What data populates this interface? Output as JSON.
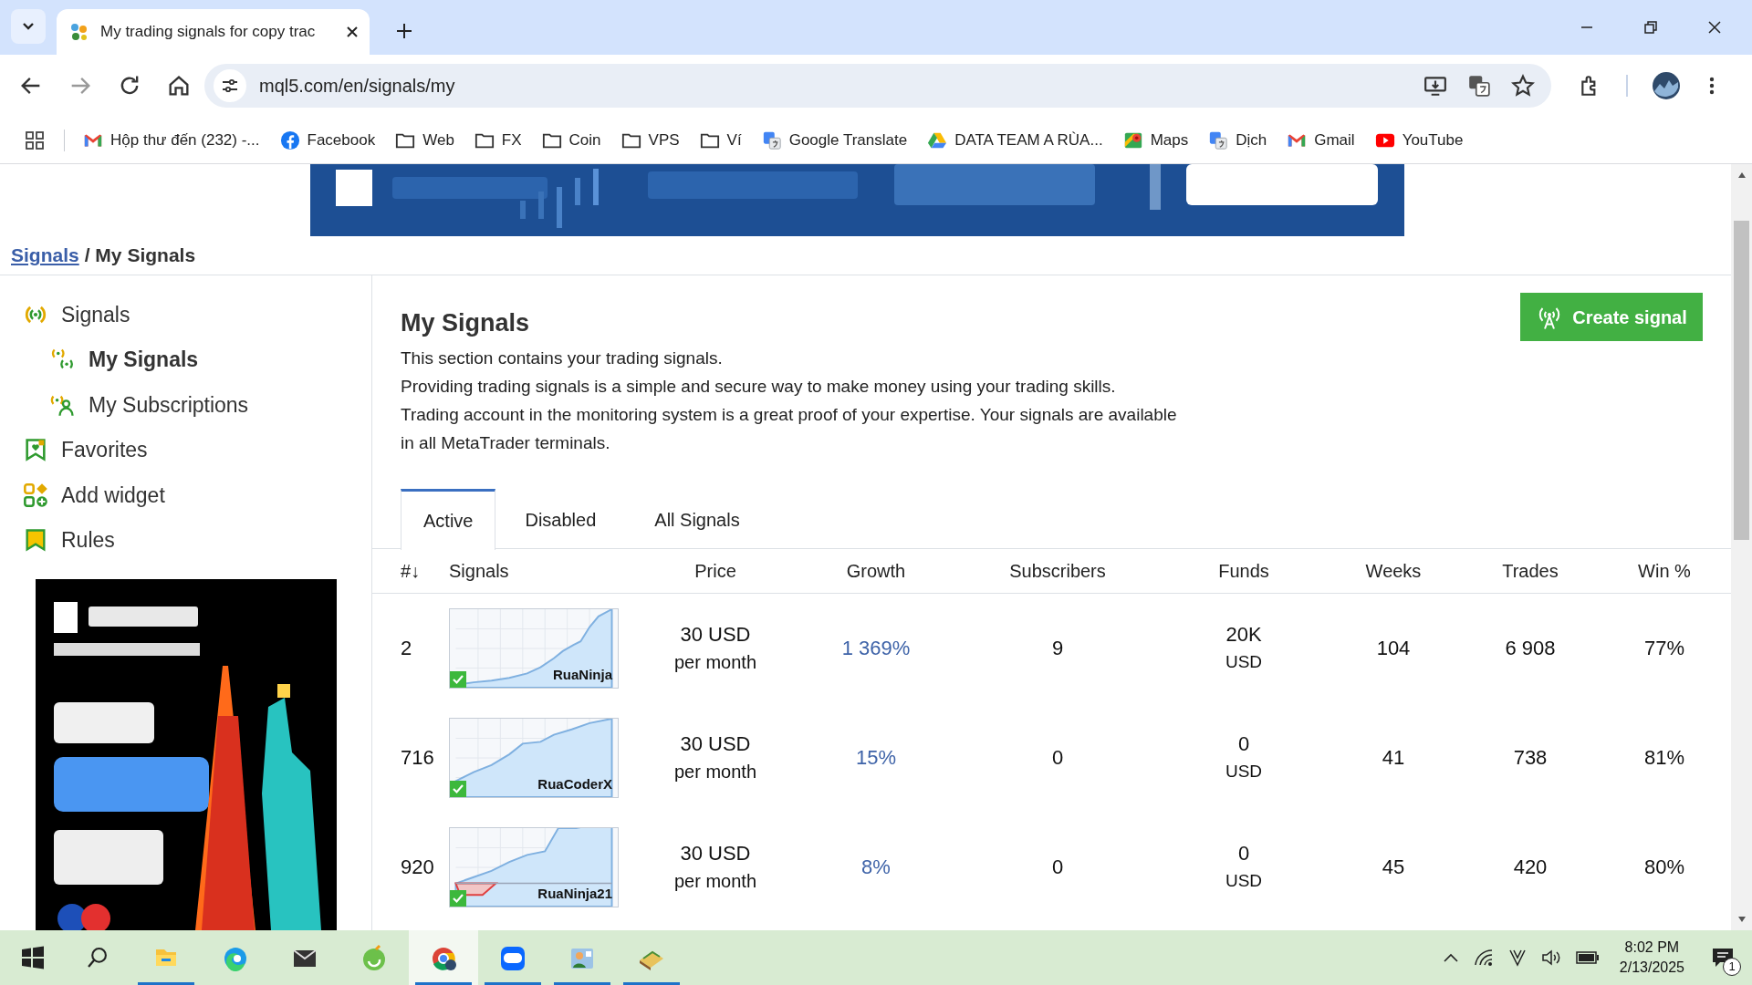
{
  "browser": {
    "tab": {
      "title": "My trading signals for copy trac"
    },
    "address": "mql5.com/en/signals/my",
    "bookmarks": [
      {
        "kind": "gmail",
        "label": "Hộp thư đến (232) -..."
      },
      {
        "kind": "facebook",
        "label": "Facebook"
      },
      {
        "kind": "folder",
        "label": "Web"
      },
      {
        "kind": "folder",
        "label": "FX"
      },
      {
        "kind": "folder",
        "label": "Coin"
      },
      {
        "kind": "folder",
        "label": "VPS"
      },
      {
        "kind": "folder",
        "label": "Ví"
      },
      {
        "kind": "translate",
        "label": "Google Translate"
      },
      {
        "kind": "drive",
        "label": "DATA TEAM A RÙA..."
      },
      {
        "kind": "maps",
        "label": "Maps"
      },
      {
        "kind": "translate",
        "label": "Dịch"
      },
      {
        "kind": "gmail",
        "label": "Gmail"
      },
      {
        "kind": "youtube",
        "label": "YouTube"
      }
    ]
  },
  "breadcrumb": {
    "link": "Signals",
    "current": "/ My Signals"
  },
  "sidebar": {
    "items": [
      {
        "kind": "signal",
        "label": "Signals",
        "selected": false,
        "children": [
          {
            "kind": "signals",
            "label": "My Signals",
            "selected": true
          },
          {
            "kind": "subscriber",
            "label": "My Subscriptions",
            "selected": false
          }
        ]
      },
      {
        "kind": "favorite",
        "label": "Favorites",
        "selected": false
      },
      {
        "kind": "widget",
        "label": "Add widget",
        "selected": false
      },
      {
        "kind": "rules",
        "label": "Rules",
        "selected": false
      }
    ]
  },
  "page": {
    "title": "My Signals",
    "create_button": "Create signal",
    "description": [
      "This section contains your trading signals.",
      "Providing trading signals is a simple and secure way to make money using your trading skills.",
      "Trading account in the monitoring system is a great proof of your expertise. Your signals are available in all MetaTrader terminals."
    ]
  },
  "tabs": [
    {
      "label": "Active",
      "selected": true
    },
    {
      "label": "Disabled",
      "selected": false
    },
    {
      "label": "All Signals",
      "selected": false
    }
  ],
  "table": {
    "columns": [
      "#↓",
      "Signals",
      "Price",
      "Growth",
      "Subscribers",
      "Funds",
      "Weeks",
      "Trades",
      "Win %"
    ],
    "rows": [
      {
        "rank": "2",
        "signal": "RuaNinja",
        "price": "30 USD",
        "price_period": "per month",
        "growth": "1 369%",
        "subscribers": "9",
        "funds": "20K",
        "funds_currency": "USD",
        "weeks": "104",
        "trades": "6 908",
        "win": "77%"
      },
      {
        "rank": "716",
        "signal": "RuaCoderX",
        "price": "30 USD",
        "price_period": "per month",
        "growth": "15%",
        "subscribers": "0",
        "funds": "0",
        "funds_currency": "USD",
        "weeks": "41",
        "trades": "738",
        "win": "81%"
      },
      {
        "rank": "920",
        "signal": "RuaNinja21",
        "price": "30 USD",
        "price_period": "per month",
        "growth": "8%",
        "subscribers": "0",
        "funds": "0",
        "funds_currency": "USD",
        "weeks": "45",
        "trades": "420",
        "win": "80%"
      }
    ]
  },
  "taskbar": {
    "apps": [
      {
        "kind": "explorer",
        "open": true,
        "selected": false
      },
      {
        "kind": "edge",
        "open": false,
        "selected": false
      },
      {
        "kind": "mail",
        "open": false,
        "selected": false
      },
      {
        "kind": "leaf",
        "open": false,
        "selected": false
      },
      {
        "kind": "chrome",
        "open": true,
        "selected": true
      },
      {
        "kind": "zalo",
        "open": true,
        "selected": false
      },
      {
        "kind": "people",
        "open": true,
        "selected": false
      },
      {
        "kind": "book",
        "open": true,
        "selected": false
      }
    ],
    "time": "8:02 PM",
    "date": "2/13/2025",
    "notifications": "1"
  }
}
